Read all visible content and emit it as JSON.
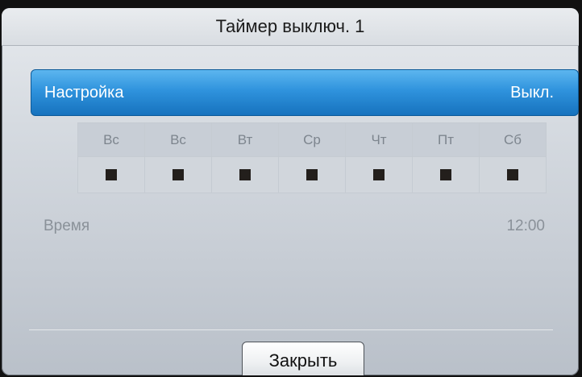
{
  "dialog": {
    "title": "Таймер выключ. 1",
    "setting": {
      "label": "Настройка",
      "value": "Выкл."
    },
    "days": [
      {
        "label": "Вс"
      },
      {
        "label": "Вс"
      },
      {
        "label": "Вт"
      },
      {
        "label": "Ср"
      },
      {
        "label": "Чт"
      },
      {
        "label": "Пт"
      },
      {
        "label": "Сб"
      }
    ],
    "time": {
      "label": "Время",
      "value": "12:00"
    },
    "close_button": "Закрыть"
  },
  "colors": {
    "selection_accent": "#2f93dd",
    "background_dark": "#111111"
  }
}
